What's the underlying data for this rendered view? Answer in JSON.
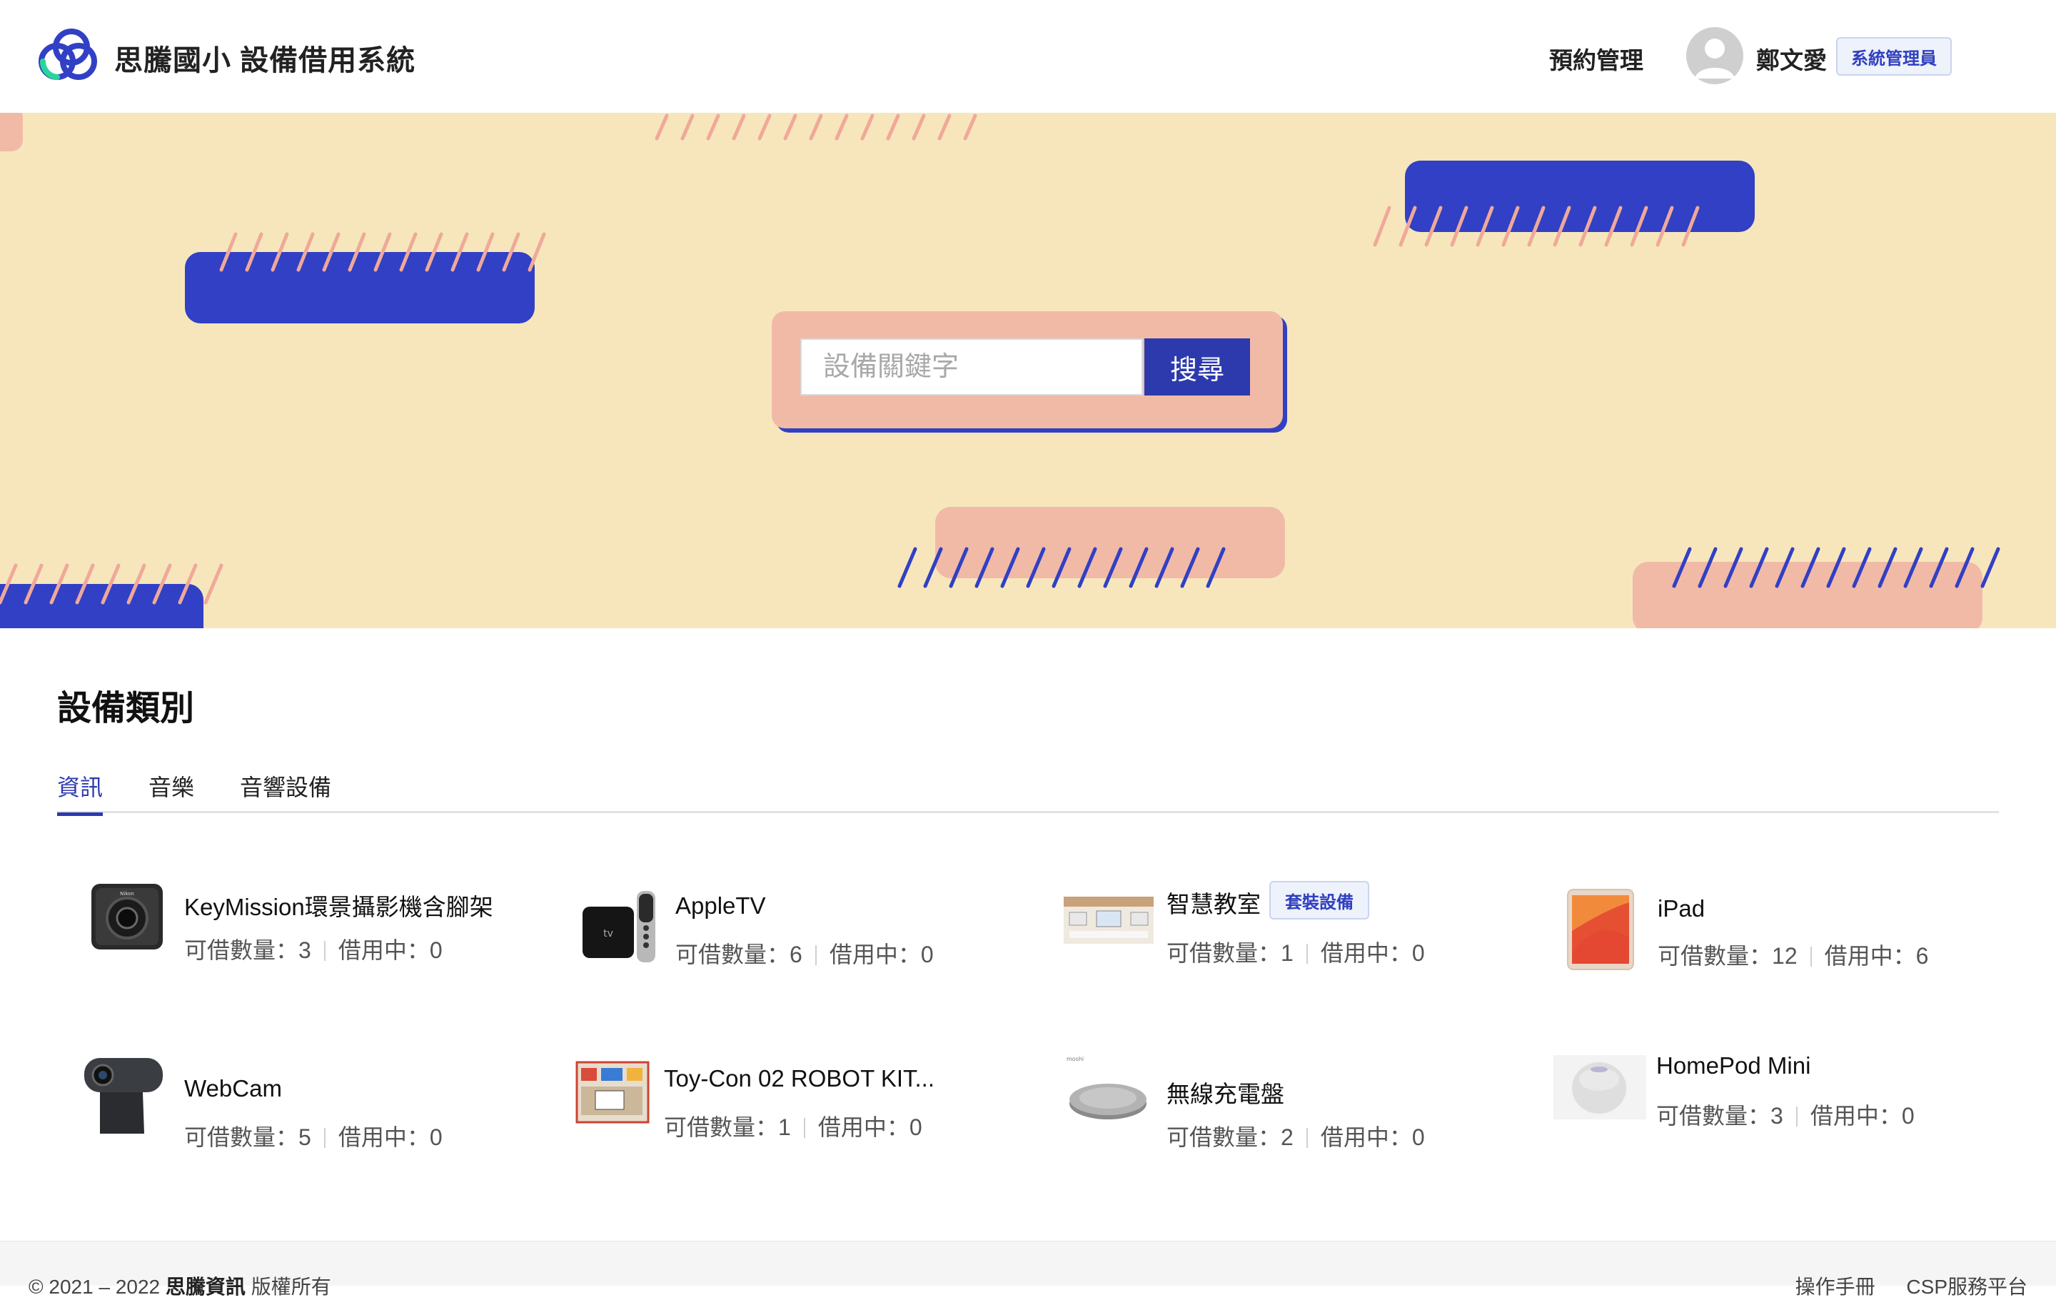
{
  "header": {
    "app_title": "思騰國小 設備借用系統",
    "nav_booking": "預約管理",
    "user_name": "鄭文愛",
    "role_badge": "系統管理員"
  },
  "search": {
    "placeholder": "設備關鍵字",
    "button_label": "搜尋"
  },
  "category": {
    "title": "設備類別",
    "tabs": [
      {
        "label": "資訊",
        "active": true
      },
      {
        "label": "音樂",
        "active": false
      },
      {
        "label": "音響設備",
        "active": false
      }
    ]
  },
  "labels": {
    "available": "可借數量：",
    "borrowed": "借用中："
  },
  "items": [
    {
      "name": "KeyMission環景攝影機含腳架",
      "available": "3",
      "borrowed": "0",
      "icon": "360-camera-icon"
    },
    {
      "name": "AppleTV",
      "available": "6",
      "borrowed": "0",
      "icon": "apple-tv-icon"
    },
    {
      "name": "智慧教室",
      "available": "1",
      "borrowed": "0",
      "badge": "套裝設備",
      "icon": "smart-classroom-icon"
    },
    {
      "name": "iPad",
      "available": "12",
      "borrowed": "6",
      "icon": "ipad-icon"
    },
    {
      "name": "WebCam",
      "available": "5",
      "borrowed": "0",
      "icon": "webcam-icon"
    },
    {
      "name": "Toy-Con 02 ROBOT KIT...",
      "available": "1",
      "borrowed": "0",
      "icon": "robot-kit-icon"
    },
    {
      "name": "無線充電盤",
      "available": "2",
      "borrowed": "0",
      "icon": "wireless-charger-icon"
    },
    {
      "name": "HomePod Mini",
      "available": "3",
      "borrowed": "0",
      "icon": "homepod-icon"
    }
  ],
  "footer": {
    "copyright_prefix": "© 2021 – 2022",
    "company": "思騰資訊",
    "rights": "版權所有",
    "links": [
      "操作手冊",
      "CSP服務平台"
    ]
  },
  "colors": {
    "brand_blue": "#3140c4",
    "hero_bg": "#f7e6bc",
    "accent_pink": "#f1baa7",
    "button_blue": "#2d3aad"
  }
}
